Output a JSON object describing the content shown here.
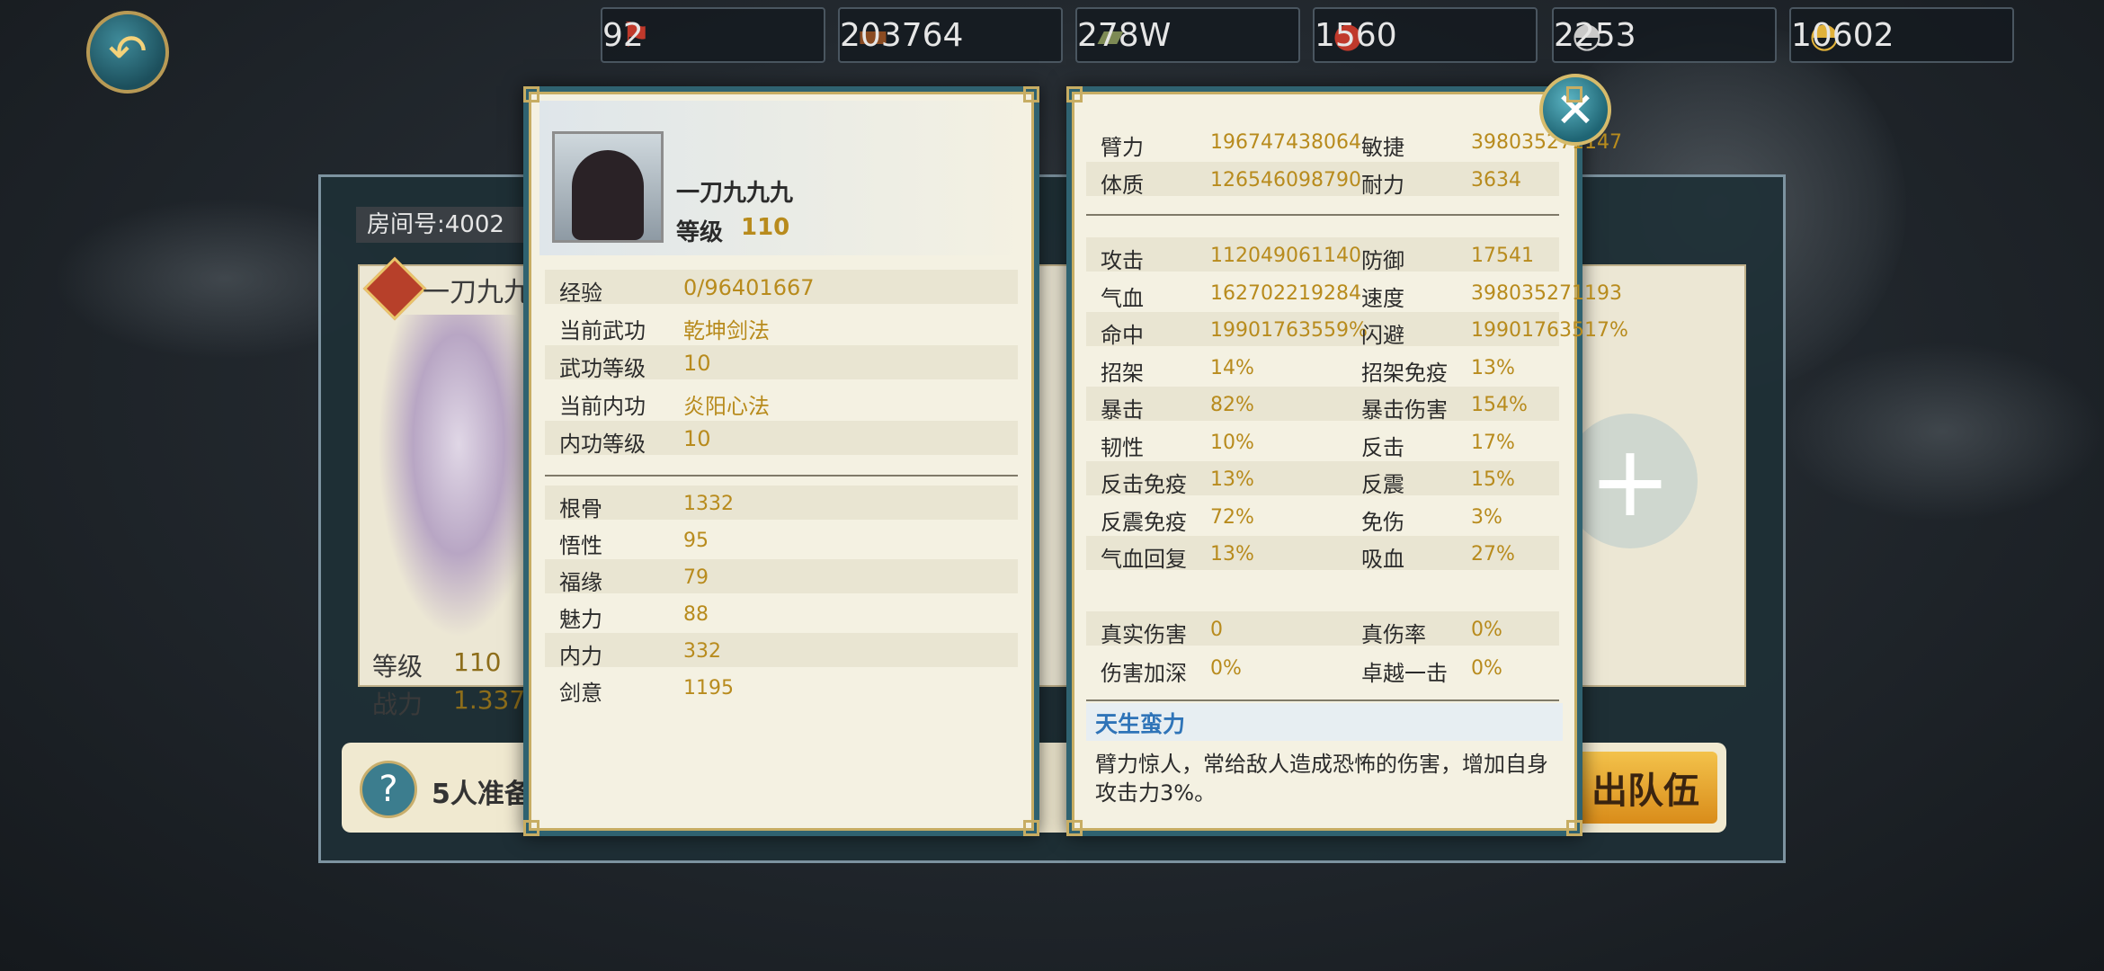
{
  "resources": [
    {
      "icon": "token-icon",
      "glyph": "⚑",
      "color": "#c0392b",
      "value": "92"
    },
    {
      "icon": "wood-icon",
      "glyph": "▬",
      "color": "#8a4b22",
      "value": "203764"
    },
    {
      "icon": "stone-icon",
      "glyph": "▰",
      "color": "#7d8a55",
      "value": "278W"
    },
    {
      "icon": "meat-icon",
      "glyph": "●",
      "color": "#c0392b",
      "value": "1560"
    },
    {
      "icon": "silver-ingot-icon",
      "glyph": "◓",
      "color": "#c9c9c9",
      "value": "2253"
    },
    {
      "icon": "gold-ingot-icon",
      "glyph": "◓",
      "color": "#e0b13a",
      "value": "10602"
    }
  ],
  "background": {
    "room_label": "房间号:4002",
    "card_name": "一刀九九",
    "card_level_label": "等级",
    "card_level": "110",
    "card_power_label": "战力",
    "card_power": "1.337",
    "ready_text": "5人准备",
    "exit_button": "出队伍"
  },
  "hero": {
    "name": "一刀九九九",
    "level_label": "等级",
    "level": "110",
    "info": [
      {
        "label": "经验",
        "value": "0/96401667"
      },
      {
        "label": "当前武功",
        "value": "乾坤剑法"
      },
      {
        "label": "武功等级",
        "value": "10"
      },
      {
        "label": "当前内功",
        "value": "炎阳心法"
      },
      {
        "label": "内功等级",
        "value": "10"
      }
    ],
    "attributes": [
      {
        "label": "根骨",
        "value": "1332"
      },
      {
        "label": "悟性",
        "value": "95"
      },
      {
        "label": "福缘",
        "value": "79"
      },
      {
        "label": "魅力",
        "value": "88"
      },
      {
        "label": "内力",
        "value": "332"
      },
      {
        "label": "剑意",
        "value": "1195"
      }
    ]
  },
  "stats": {
    "base": [
      {
        "l1": "臂力",
        "v1": "196747438064",
        "l2": "敏捷",
        "v2": "398035271147"
      },
      {
        "l1": "体质",
        "v1": "126546098790",
        "l2": "耐力",
        "v2": "3634"
      }
    ],
    "combat": [
      {
        "l1": "攻击",
        "v1": "112049061140",
        "l2": "防御",
        "v2": "17541"
      },
      {
        "l1": "气血",
        "v1": "162702219284",
        "l2": "速度",
        "v2": "398035271193"
      },
      {
        "l1": "命中",
        "v1": "19901763559%",
        "l2": "闪避",
        "v2": "19901763517%"
      },
      {
        "l1": "招架",
        "v1": "14%",
        "l2": "招架免疫",
        "v2": "13%"
      },
      {
        "l1": "暴击",
        "v1": "82%",
        "l2": "暴击伤害",
        "v2": "154%"
      },
      {
        "l1": "韧性",
        "v1": "10%",
        "l2": "反击",
        "v2": "17%"
      },
      {
        "l1": "反击免疫",
        "v1": "13%",
        "l2": "反震",
        "v2": "15%"
      },
      {
        "l1": "反震免疫",
        "v1": "72%",
        "l2": "免伤",
        "v2": "3%"
      },
      {
        "l1": "气血回复",
        "v1": "13%",
        "l2": "吸血",
        "v2": "27%"
      }
    ],
    "extra": [
      {
        "l1": "真实伤害",
        "v1": "0",
        "l2": "真伤率",
        "v2": "0%"
      },
      {
        "l1": "伤害加深",
        "v1": "0%",
        "l2": "卓越一击",
        "v2": "0%"
      }
    ]
  },
  "talent": {
    "name": "天生蛮力",
    "desc": "臂力惊人，常给敌人造成恐怖的伤害，增加自身攻击力3%。"
  },
  "icons": {
    "back": "↶",
    "close": "✕",
    "help": "?",
    "plus": "+"
  }
}
